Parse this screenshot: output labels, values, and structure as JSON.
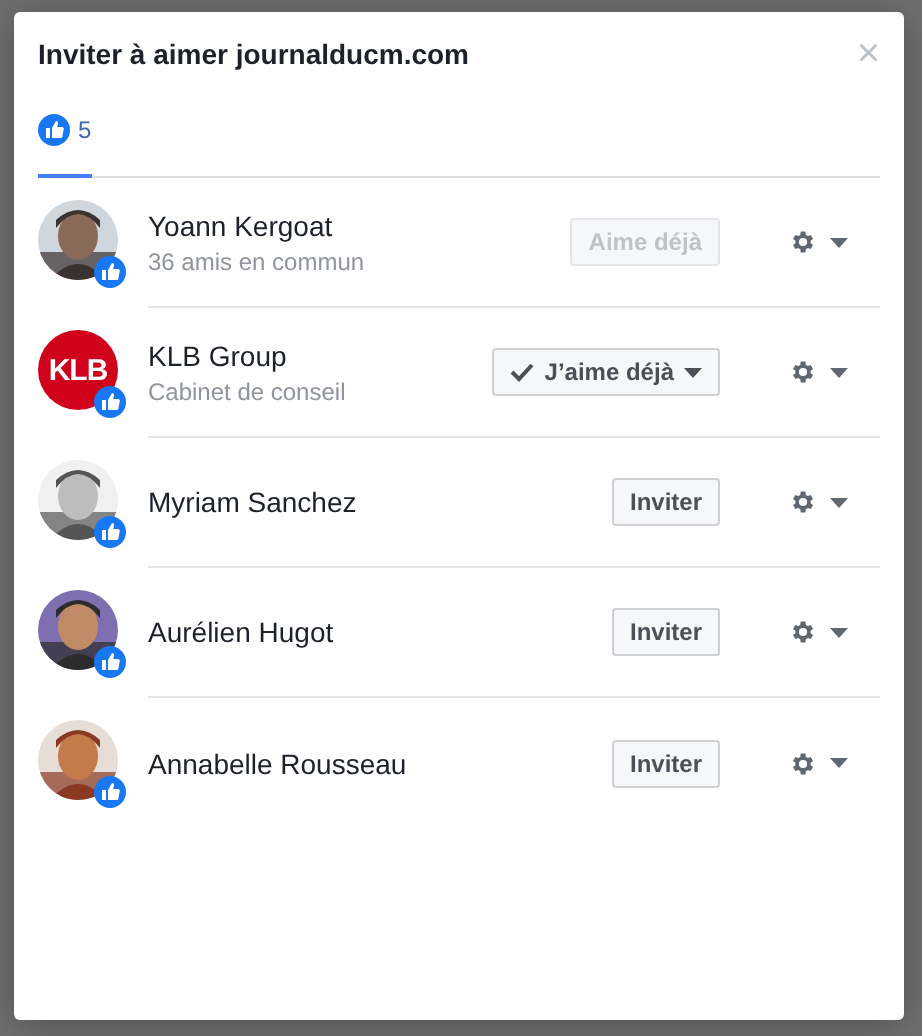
{
  "dialog": {
    "title": "Inviter à aimer journalducm.com",
    "close": "×"
  },
  "tabs": [
    {
      "count": "5",
      "selected": true
    }
  ],
  "people": [
    {
      "name": "Yoann Kergoat",
      "subtitle": "36 amis en commun",
      "kind": "status",
      "action": "Aime déjà",
      "disabled": true
    },
    {
      "name": "KLB Group",
      "subtitle": "Cabinet de conseil",
      "avatar": {
        "kind": "logo",
        "text": "KLB",
        "color": "#d0021b"
      },
      "kind": "liked",
      "action": "J’aime déjà"
    },
    {
      "name": "Myriam Sanchez",
      "kind": "invite",
      "action": "Inviter",
      "disabled": false
    },
    {
      "name": "Aurélien Hugot",
      "kind": "invite",
      "action": "Inviter",
      "disabled": false
    },
    {
      "name": "Annabelle Rousseau",
      "kind": "invite",
      "action": "Inviter",
      "disabled": false
    }
  ]
}
